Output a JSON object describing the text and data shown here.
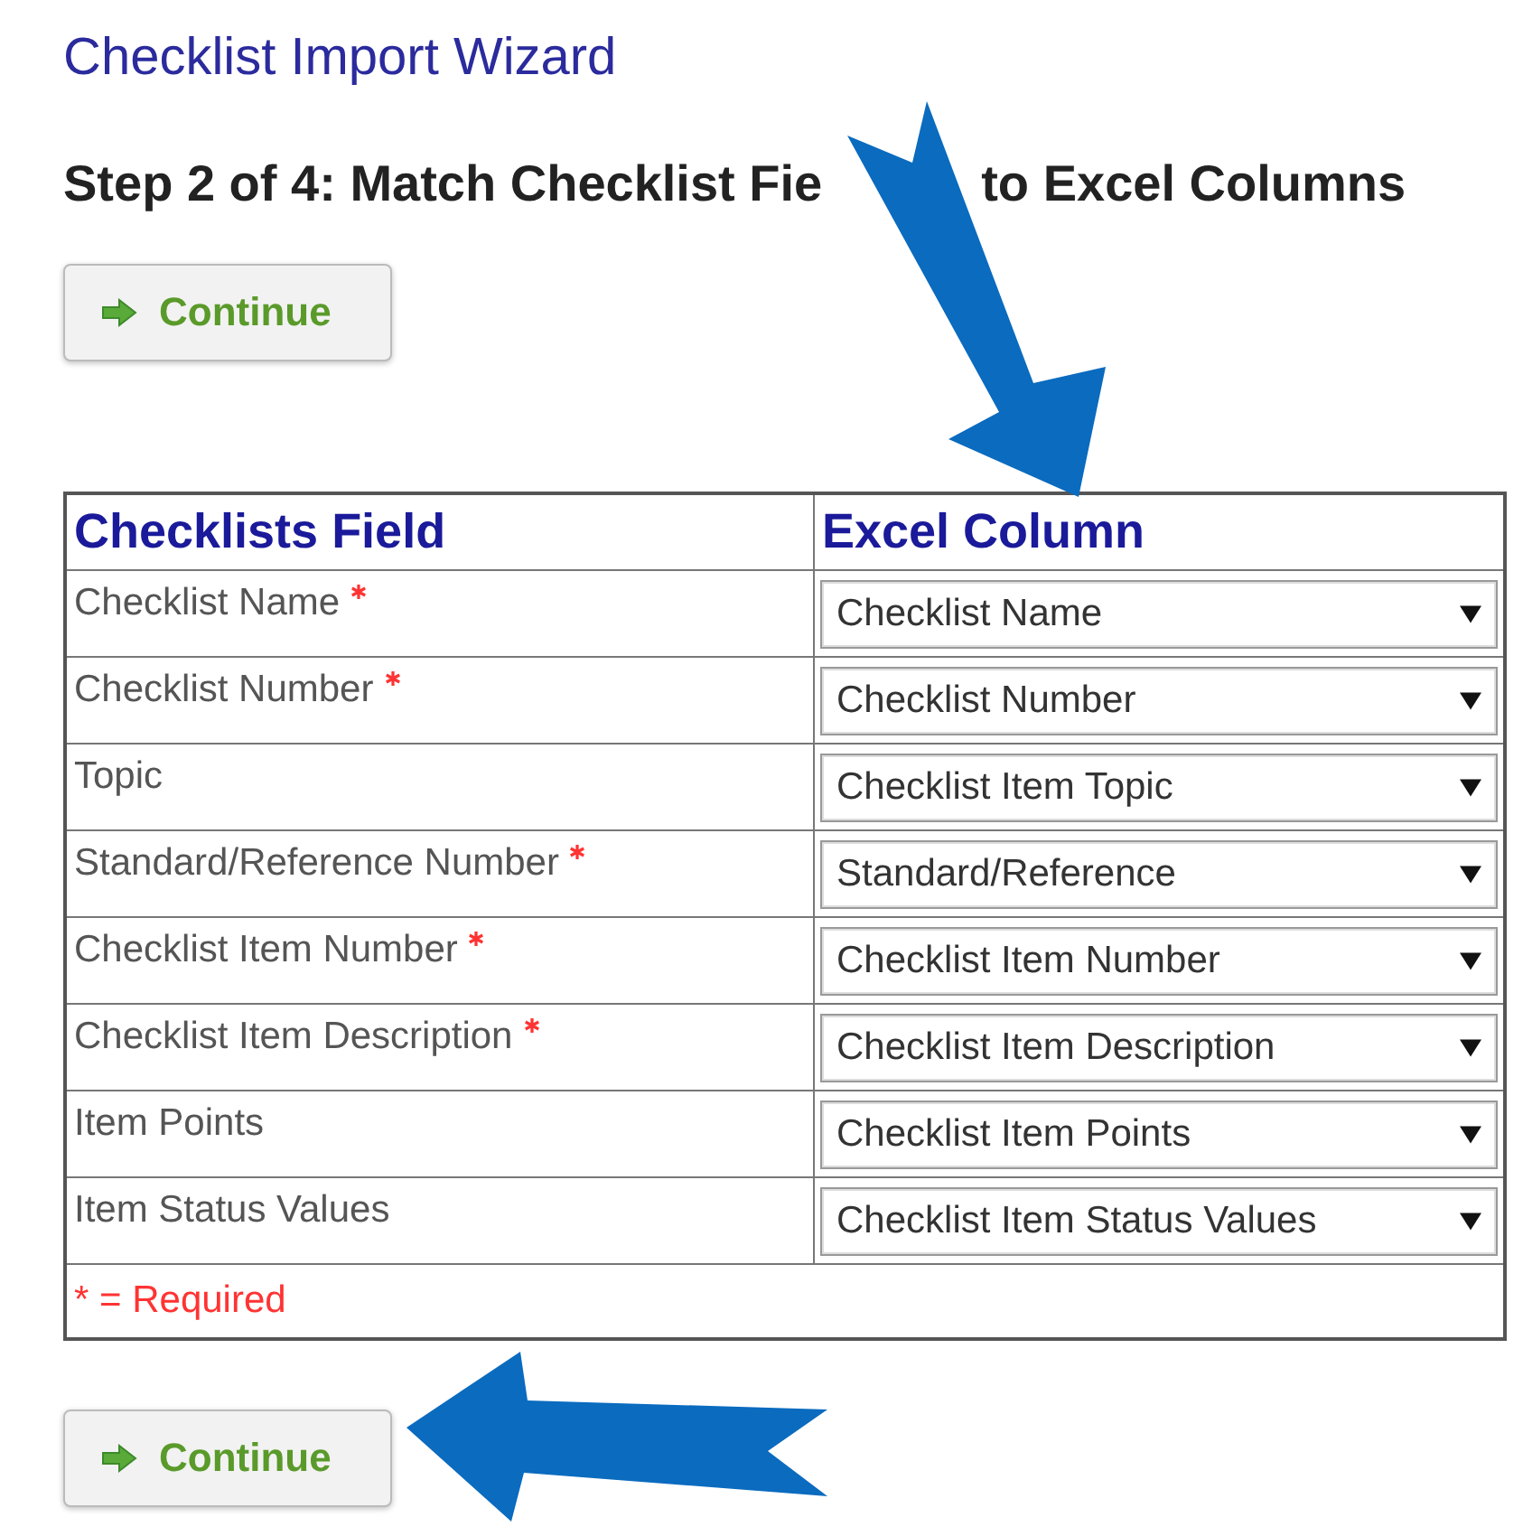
{
  "page_title": "Checklist Import Wizard",
  "step_heading": {
    "before_arrow": "Step 2 of 4: Match Checklist Fie",
    "after_arrow": "to Excel Columns"
  },
  "continue_button_top": "Continue",
  "table": {
    "columns": [
      "Checklists Field",
      "Excel Column"
    ],
    "rows": [
      {
        "field": "Checklist Name",
        "required": true,
        "column": "Checklist Name"
      },
      {
        "field": "Checklist Number",
        "required": true,
        "column": "Checklist Number"
      },
      {
        "field": "Topic",
        "required": false,
        "column": "Checklist Item Topic"
      },
      {
        "field": "Standard/Reference Number",
        "required": true,
        "column": "Standard/Reference"
      },
      {
        "field": "Checklist Item Number",
        "required": true,
        "column": "Checklist Item Number"
      },
      {
        "field": "Checklist Item Description",
        "required": true,
        "column": "Checklist Item Description"
      },
      {
        "field": "Item Points",
        "required": false,
        "column": "Checklist Item Points"
      },
      {
        "field": "Item Status Values",
        "required": false,
        "column": "Checklist Item Status Values"
      }
    ],
    "footer": "* = Required"
  },
  "continue_button_bottom": "Continue"
}
